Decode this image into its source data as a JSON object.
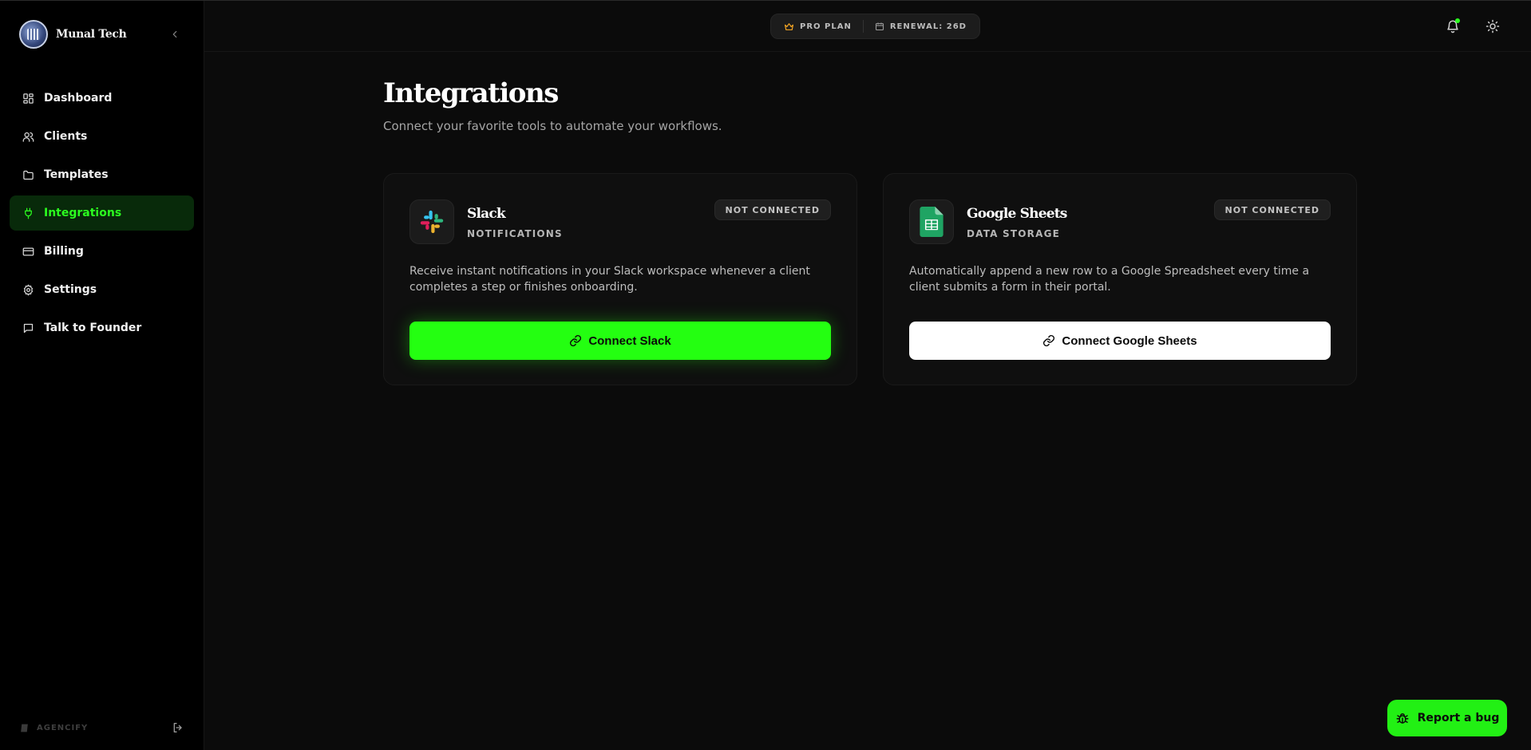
{
  "brand": {
    "name": "Munal Tech"
  },
  "sidebar": {
    "items": [
      {
        "label": "Dashboard",
        "icon": "grid-icon"
      },
      {
        "label": "Clients",
        "icon": "users-icon"
      },
      {
        "label": "Templates",
        "icon": "folder-icon"
      },
      {
        "label": "Integrations",
        "icon": "plug-icon",
        "active": true
      },
      {
        "label": "Billing",
        "icon": "credit-card-icon"
      },
      {
        "label": "Settings",
        "icon": "gear-icon"
      },
      {
        "label": "Talk to Founder",
        "icon": "message-icon"
      }
    ],
    "footer_label": "AGENCIFY"
  },
  "topbar": {
    "plan_label": "PRO PLAN",
    "renewal_label": "RENEWAL: 26D"
  },
  "page": {
    "title": "Integrations",
    "subtitle": "Connect your favorite tools to automate your workflows."
  },
  "integrations": [
    {
      "name": "Slack",
      "category": "NOTIFICATIONS",
      "status": "NOT CONNECTED",
      "description": "Receive instant notifications in your Slack workspace whenever a client completes a step or finishes onboarding.",
      "button_label": "Connect Slack"
    },
    {
      "name": "Google Sheets",
      "category": "DATA STORAGE",
      "status": "NOT CONNECTED",
      "description": "Automatically append a new row to a Google Spreadsheet every time a client submits a form in their portal.",
      "button_label": "Connect Google Sheets"
    }
  ],
  "report_bug_label": "Report a bug",
  "colors": {
    "accent": "#24ff11",
    "background": "#0b0b0b",
    "sidebar": "#000000",
    "active_nav_bg": "#082a0a"
  }
}
